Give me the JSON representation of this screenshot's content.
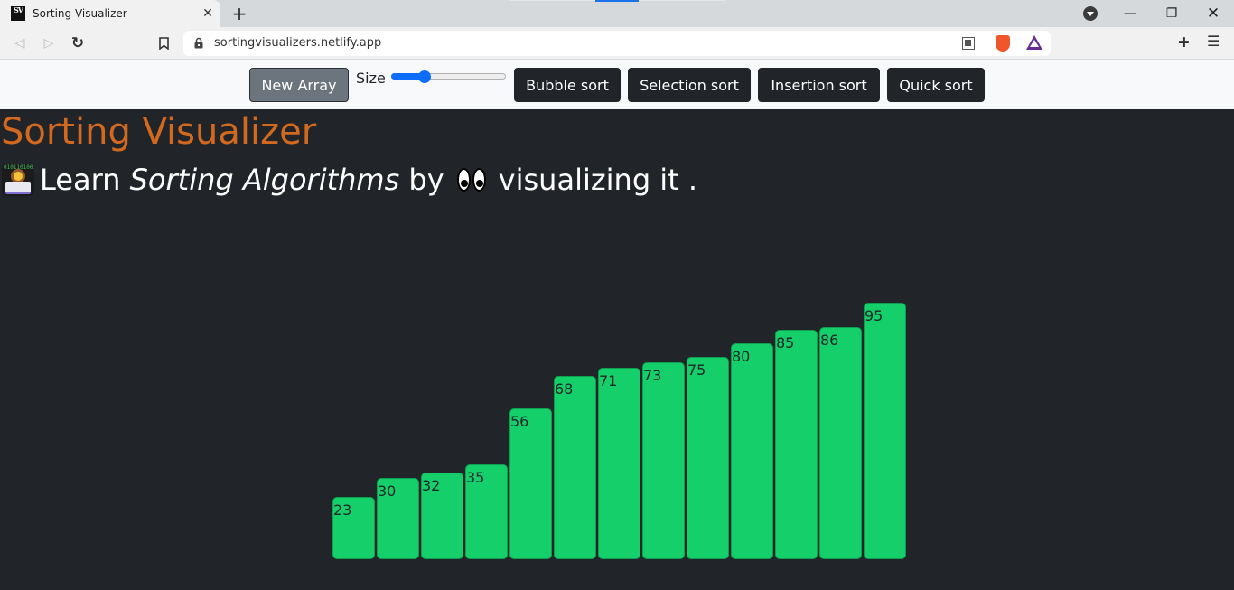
{
  "browser": {
    "tab_title": "Sorting Visualizer",
    "favicon_text": "SV",
    "url": "sortingvisualizers.netlify.app",
    "icons": [
      "back-icon",
      "forward-icon",
      "reload-icon",
      "bookmark-icon",
      "lock-icon",
      "qr-code-icon",
      "brave-shield-icon",
      "bat-rewards-icon",
      "extensions-icon",
      "menu-icon"
    ]
  },
  "toolbar": {
    "new_array_label": "New Array",
    "size_label": "Size",
    "size_slider_fraction": 0.29,
    "buttons": [
      "Bubble sort",
      "Selection sort",
      "Insertion sort",
      "Quick sort"
    ],
    "accent_color": "#0d6efd"
  },
  "page": {
    "title": "Sorting Visualizer",
    "title_color": "#d2691e",
    "tagline": {
      "prefix": "Learn",
      "emphasis": "Sorting Algorithms",
      "middle": "by",
      "suffix": "visualizing it ."
    }
  },
  "chart_data": {
    "type": "bar",
    "values": [
      23,
      30,
      32,
      35,
      56,
      68,
      71,
      73,
      75,
      80,
      85,
      86,
      95
    ],
    "bar_color": "#14cf6a",
    "labels_shown": true
  }
}
